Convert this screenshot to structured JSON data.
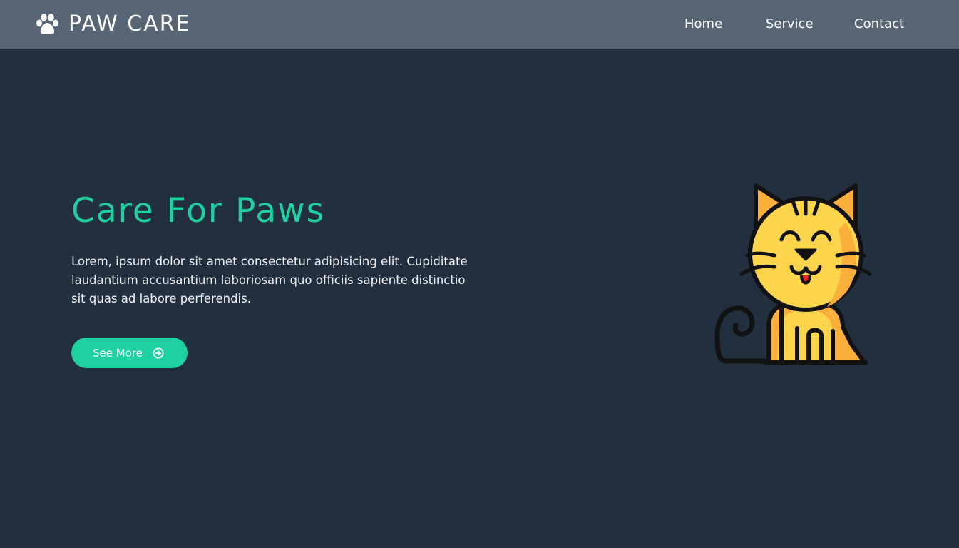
{
  "header": {
    "logo_text": "PAW CARE",
    "logo_icon": "paw-icon",
    "nav": [
      {
        "label": "Home"
      },
      {
        "label": "Service"
      },
      {
        "label": "Contact"
      }
    ]
  },
  "hero": {
    "title": "Care For Paws",
    "description": "Lorem, ipsum dolor sit amet consectetur adipisicing elit. Cupiditate laudantium accusantium laboriosam quo officiis sapiente distinctio sit quas ad labore perferendis.",
    "button_label": "See More",
    "button_icon": "arrow-circle-right-icon",
    "illustration": "cat-icon"
  },
  "colors": {
    "navbar_bg": "#576574",
    "page_bg": "#222f3e",
    "accent": "#1dd1a1",
    "text": "#ffffff"
  }
}
